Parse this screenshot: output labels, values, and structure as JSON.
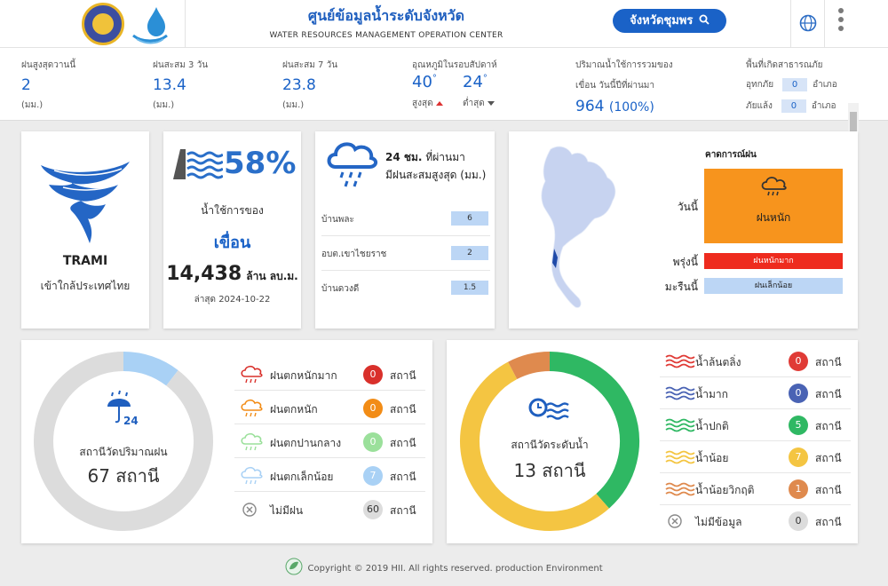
{
  "header": {
    "title_th": "ศูนย์ข้อมูลน้ำระดับจังหวัด",
    "title_en": "WATER RESOURCES MANAGEMENT OPERATION CENTER",
    "province_button": "จังหวัดชุมพร"
  },
  "stats": {
    "max_rain_today": {
      "label": "ฝนสูงสุดวานนี้",
      "value": "2",
      "unit": "(มม.)"
    },
    "rain_3d": {
      "label": "ฝนสะสม 3 วัน",
      "value": "13.4",
      "unit": "(มม.)"
    },
    "rain_7d": {
      "label": "ฝนสะสม 7 วัน",
      "value": "23.8",
      "unit": "(มม.)"
    },
    "temperature": {
      "label": "อุณหภูมิในรอบสัปดาห์",
      "max": "40",
      "min": "24",
      "max_label": "สูงสุด",
      "min_label": "ต่ำสุด"
    },
    "water_use": {
      "label_line1": "ปริมาณน้ำใช้การรวมของ",
      "label_line2": "เขื่อน วันนี้ปีที่ผ่านมา",
      "value": "964",
      "pct": "(100%)"
    },
    "disaster": {
      "label": "พื้นที่เกิดสาธารณภัย",
      "flood_label": "อุทกภัย",
      "flood_value": "0",
      "drought_label": "ภัยแล้ง",
      "drought_value": "0",
      "unit": "อำเภอ"
    }
  },
  "storm": {
    "name": "TRAMI",
    "desc": "เข้าใกล้ประเทศไทย"
  },
  "dam": {
    "percent": "58%",
    "line1": "น้ำใช้การของ",
    "line2": "เขื่อน",
    "volume": "14,438",
    "volume_unit": "ล้าน ลบ.ม.",
    "updated": "ล่าสุด 2024-10-22"
  },
  "rain24": {
    "title_bold": "24 ชม.",
    "title_rest": "ที่ผ่านมา",
    "title_line2": "มีฝนสะสมสูงสุด (มม.)",
    "rows": [
      {
        "name": "บ้านพละ",
        "value": "6"
      },
      {
        "name": "อบต.เขาไชยราช",
        "value": "2"
      },
      {
        "name": "บ้านดวงดี",
        "value": "1.5"
      }
    ]
  },
  "forecast": {
    "title": "คาดการณ์ฝน",
    "today_label": "วันนี้",
    "today_value": "ฝนหนัก",
    "tomorrow_label": "พรุ่งนี้",
    "tomorrow_value": "ฝนหนักมาก",
    "dayafter_label": "มะรืนนี้",
    "dayafter_value": "ฝนเล็กน้อย",
    "colors": {
      "today": "#f7941d",
      "tomorrow": "#ee2b1e",
      "dayafter": "#bcd6f5"
    }
  },
  "rain_stations": {
    "label": "สถานีวัดปริมาณฝน",
    "count_text": "67 สถานี",
    "icon_text": "24",
    "legend": [
      {
        "name": "ฝนตกหนักมาก",
        "count": "0",
        "unit": "สถานี",
        "color": "#d9302b"
      },
      {
        "name": "ฝนตกหนัก",
        "count": "0",
        "unit": "สถานี",
        "color": "#f28c16"
      },
      {
        "name": "ฝนตกปานกลาง",
        "count": "0",
        "unit": "สถานี",
        "color": "#9be09b"
      },
      {
        "name": "ฝนตกเล็กน้อย",
        "count": "7",
        "unit": "สถานี",
        "color": "#a9d1f5"
      },
      {
        "name": "ไม่มีฝน",
        "count": "60",
        "unit": "สถานี",
        "color": "#dcdcdc"
      }
    ]
  },
  "water_stations": {
    "label": "สถานีวัดระดับน้ำ",
    "count_text": "13 สถานี",
    "legend": [
      {
        "name": "น้ำล้นตลิ่ง",
        "count": "0",
        "unit": "สถานี",
        "color": "#e03b36"
      },
      {
        "name": "น้ำมาก",
        "count": "0",
        "unit": "สถานี",
        "color": "#4a63b4"
      },
      {
        "name": "น้ำปกติ",
        "count": "5",
        "unit": "สถานี",
        "color": "#2fb863"
      },
      {
        "name": "น้ำน้อย",
        "count": "7",
        "unit": "สถานี",
        "color": "#f4c542"
      },
      {
        "name": "น้ำน้อยวิกฤติ",
        "count": "1",
        "unit": "สถานี",
        "color": "#df8a4e"
      },
      {
        "name": "ไม่มีข้อมูล",
        "count": "0",
        "unit": "สถานี",
        "color": "#dcdcdc"
      }
    ]
  },
  "footer": "Copyright © 2019 HII. All rights reserved. production Environment"
}
